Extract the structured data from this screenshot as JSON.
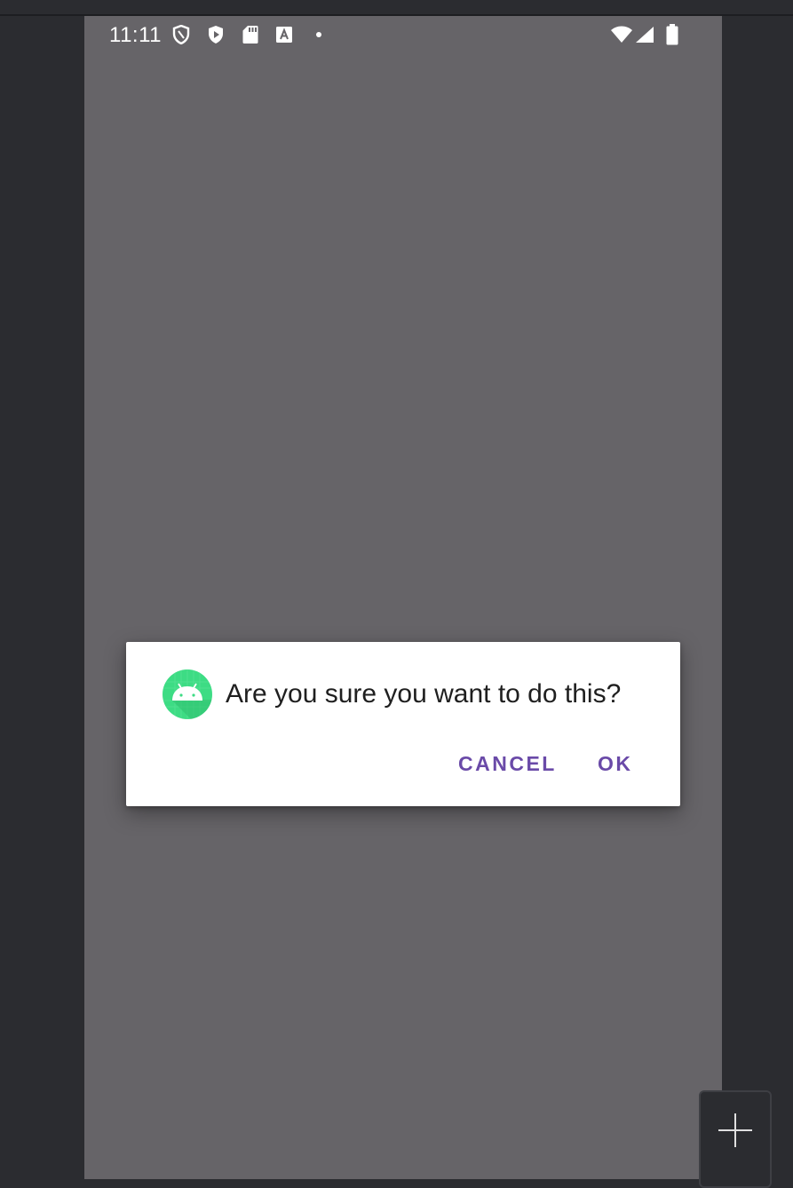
{
  "status_bar": {
    "time": "11:11",
    "left_icons": [
      "shield-outline-icon",
      "play-shield-icon",
      "sd-card-icon",
      "text-a-icon",
      "dot-icon"
    ],
    "right_icons": [
      "wifi-icon",
      "signal-icon",
      "battery-icon"
    ]
  },
  "dialog": {
    "icon": "android-app-icon",
    "title": "Are you sure you want to do this?",
    "cancel_label": "CANCEL",
    "ok_label": "OK"
  },
  "side_controls": {
    "add_icon": "plus-icon"
  },
  "colors": {
    "scrim": "#666468",
    "accent": "#6a4aa8",
    "icon_green": "#3ddc84",
    "frame": "#2b2c30"
  }
}
